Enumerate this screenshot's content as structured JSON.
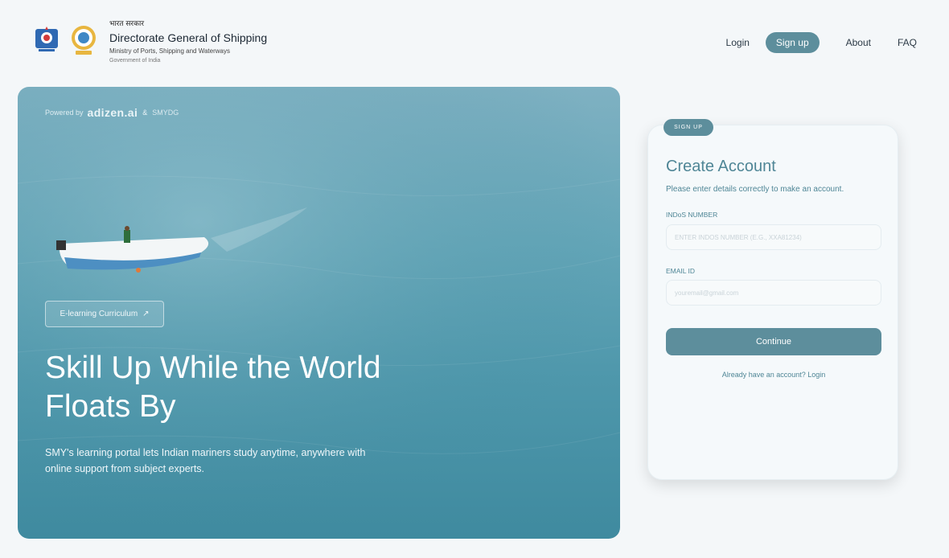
{
  "header": {
    "hindi": "भारत सरकार",
    "org_name": "Directorate General of Shipping",
    "ministry": "Ministry of Ports, Shipping and Waterways",
    "government": "Government of India",
    "nav": {
      "login": "Login",
      "signup": "Sign up",
      "about": "About",
      "faq": "FAQ"
    }
  },
  "hero": {
    "powered_by": "Powered by",
    "partner1": "adizen.ai",
    "amp": "&",
    "partner2": "SMYDG",
    "elearning_label": "E-learning Curriculum",
    "headline": "Skill Up While the World Floats By",
    "subtext": "SMY's learning portal lets Indian mariners study anytime, anywhere with online support from subject experts."
  },
  "signup": {
    "tag": "SIGN UP",
    "title": "Create Account",
    "description": "Please enter details correctly to make an account.",
    "indos_label": "INDoS NUMBER",
    "indos_placeholder": "ENTER INDOS NUMBER (E.G., XXA81234)",
    "email_label": "EMAIL ID",
    "email_placeholder": "youremail@gmail.com",
    "continue_label": "Continue",
    "login_prompt": "Already have an account? Login"
  },
  "colors": {
    "accent": "#5d8e9c",
    "accent_text": "#4f8696",
    "background": "#f4f7f9"
  }
}
